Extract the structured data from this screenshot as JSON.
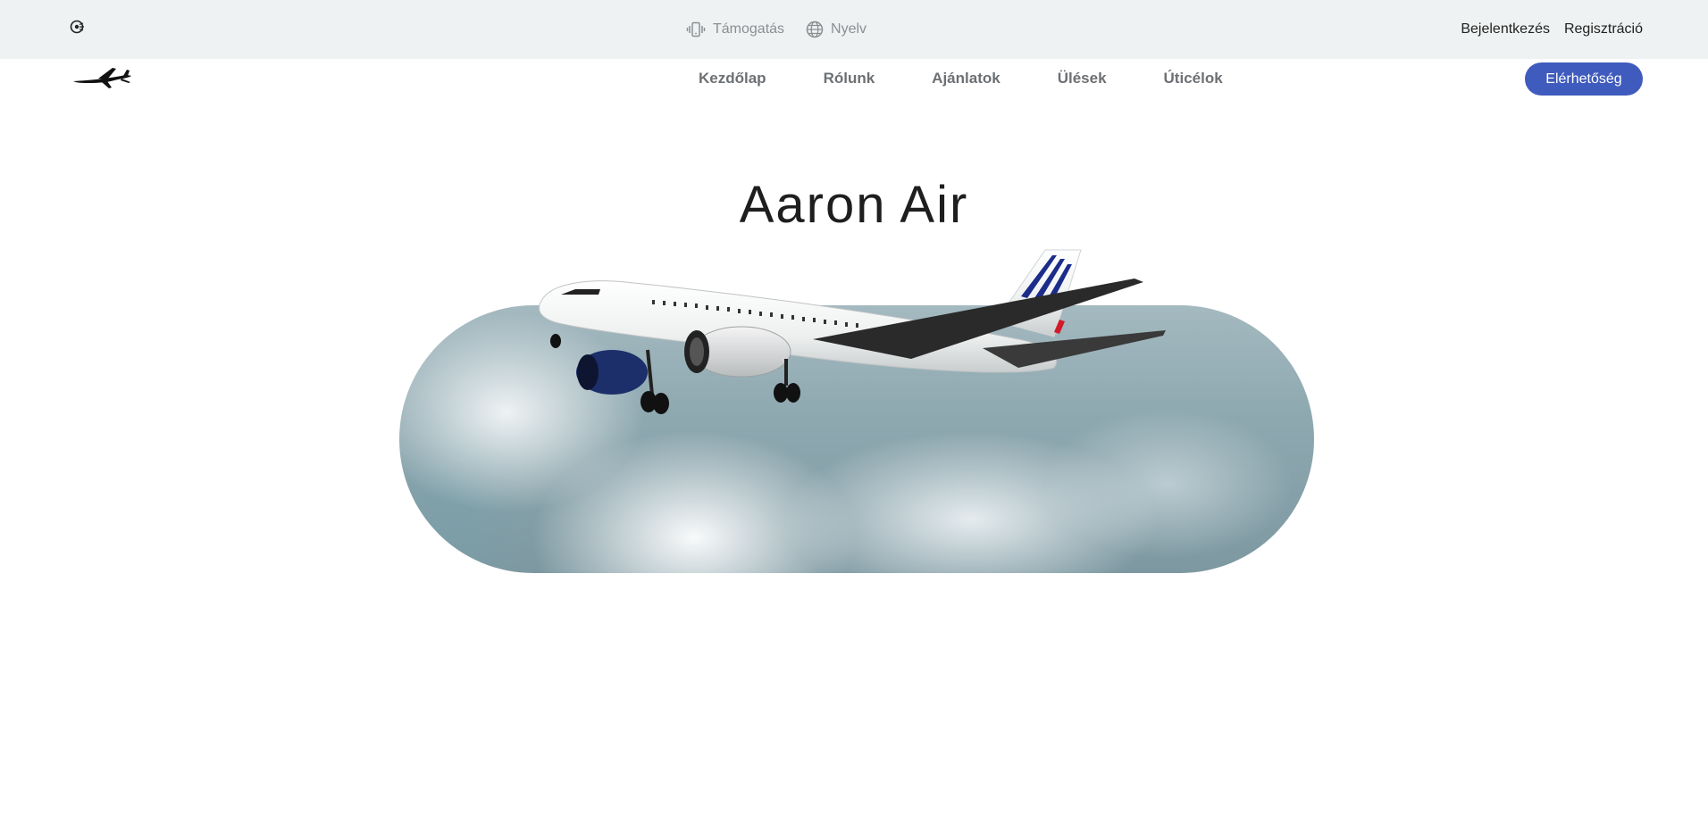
{
  "topbar": {
    "support_label": "Támogatás",
    "language_label": "Nyelv",
    "login_label": "Bejelentkezés",
    "register_label": "Regisztráció",
    "icons": {
      "accessibility": "accessibility-icon",
      "support": "phone-vibrate-icon",
      "language": "globe-icon"
    }
  },
  "nav": {
    "logo_icon": "airplane-logo-icon",
    "links": [
      {
        "label": "Kezdőlap"
      },
      {
        "label": "Rólunk"
      },
      {
        "label": "Ajánlatok"
      },
      {
        "label": "Ülések"
      },
      {
        "label": "Úticélok"
      }
    ],
    "contact_label": "Elérhetőség"
  },
  "hero": {
    "title": "Aaron Air"
  },
  "colors": {
    "topbar_bg": "#eff2f2",
    "accent": "#3f5bbd",
    "nav_text": "#6d7073",
    "util_text": "#8a8f93"
  }
}
